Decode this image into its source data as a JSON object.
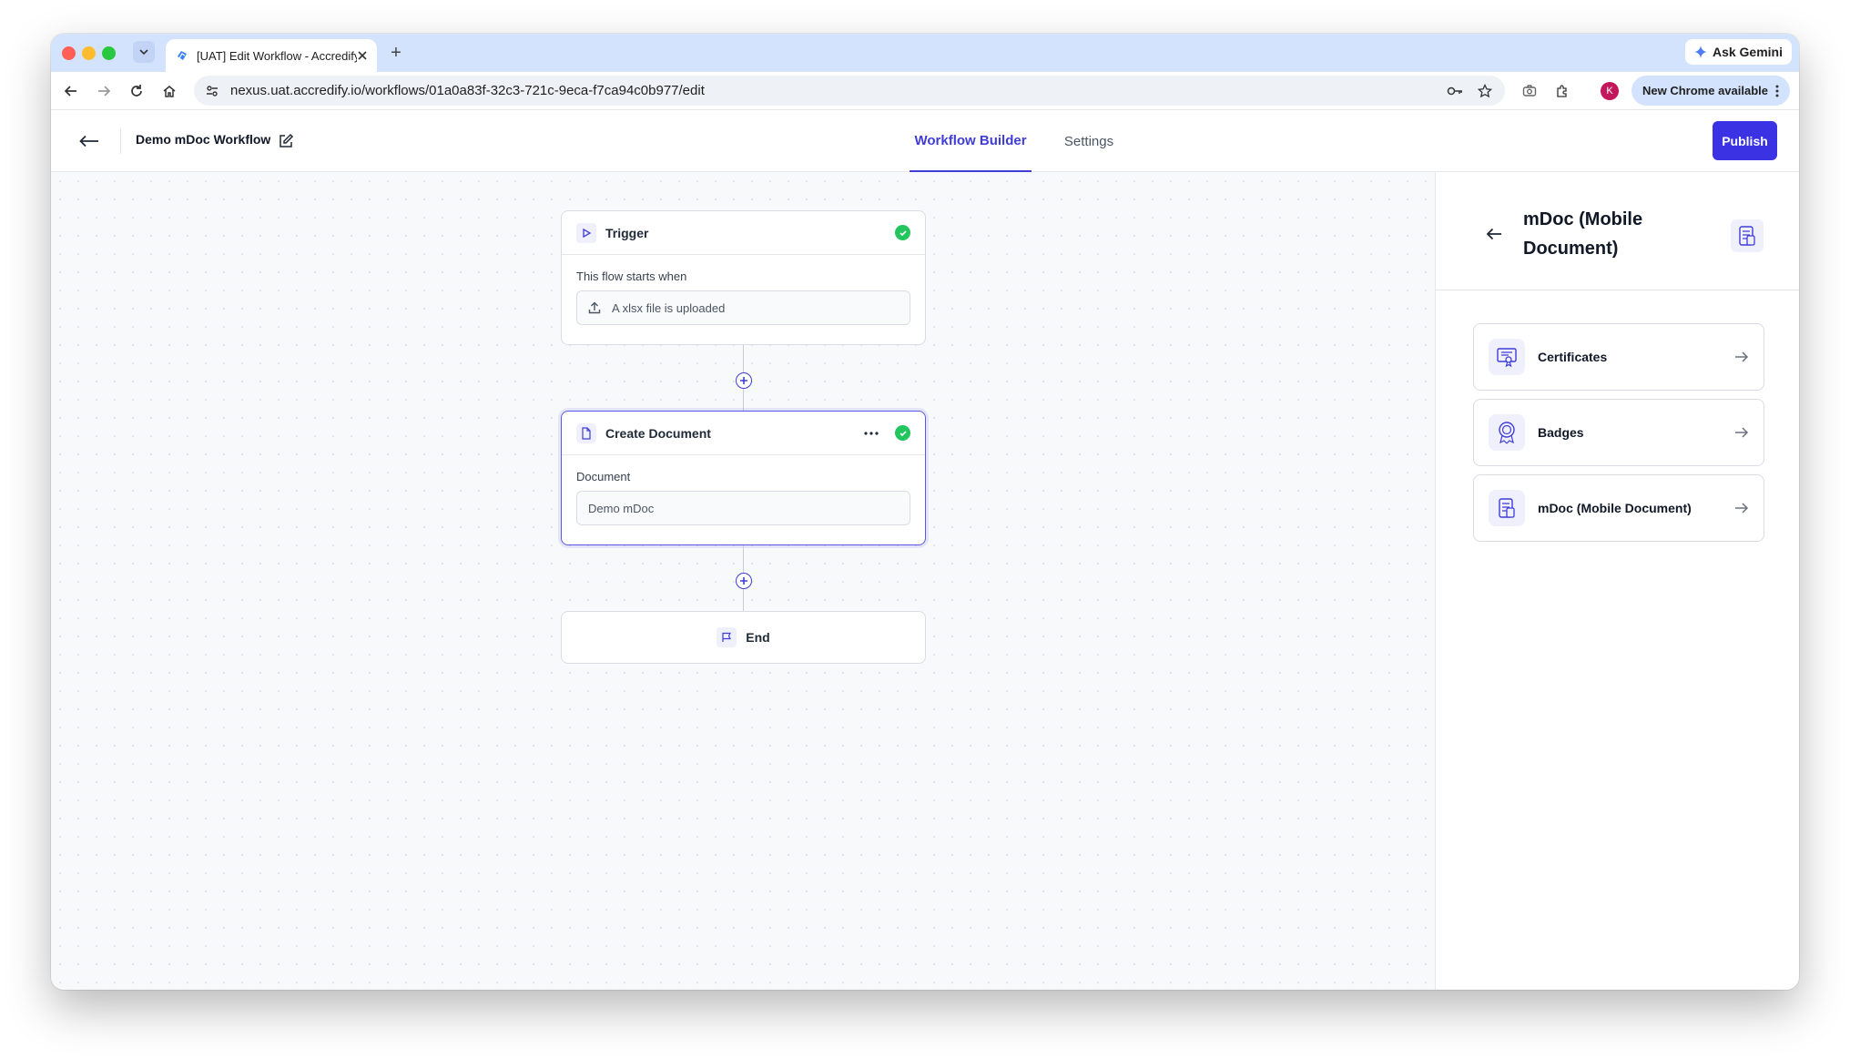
{
  "browser": {
    "tab_title": "[UAT] Edit Workflow - Accredify",
    "url": "nexus.uat.accredify.io/workflows/01a0a83f-32c3-721c-9eca-f7ca94c0b977/edit",
    "ask_gemini": "Ask Gemini",
    "new_chrome": "New Chrome available",
    "profile_initial": "K"
  },
  "header": {
    "workflow_name": "Demo mDoc Workflow",
    "tabs": [
      {
        "label": "Workflow Builder",
        "active": true
      },
      {
        "label": "Settings",
        "active": false
      }
    ],
    "publish_label": "Publish"
  },
  "nodes": {
    "trigger": {
      "title": "Trigger",
      "label": "This flow starts when",
      "value": "A xlsx file is uploaded"
    },
    "create_document": {
      "title": "Create Document",
      "label": "Document",
      "value": "Demo mDoc"
    },
    "end": {
      "title": "End"
    }
  },
  "panel": {
    "title": "mDoc (Mobile Document)",
    "items": [
      {
        "label": "Certificates",
        "icon": "certificate-icon"
      },
      {
        "label": "Badges",
        "icon": "badge-icon"
      },
      {
        "label": "mDoc (Mobile Document)",
        "icon": "mdoc-icon"
      }
    ]
  },
  "colors": {
    "accent": "#3f3dd6",
    "success": "#22c55e",
    "chrome_tabbar": "#d3e3fd"
  }
}
